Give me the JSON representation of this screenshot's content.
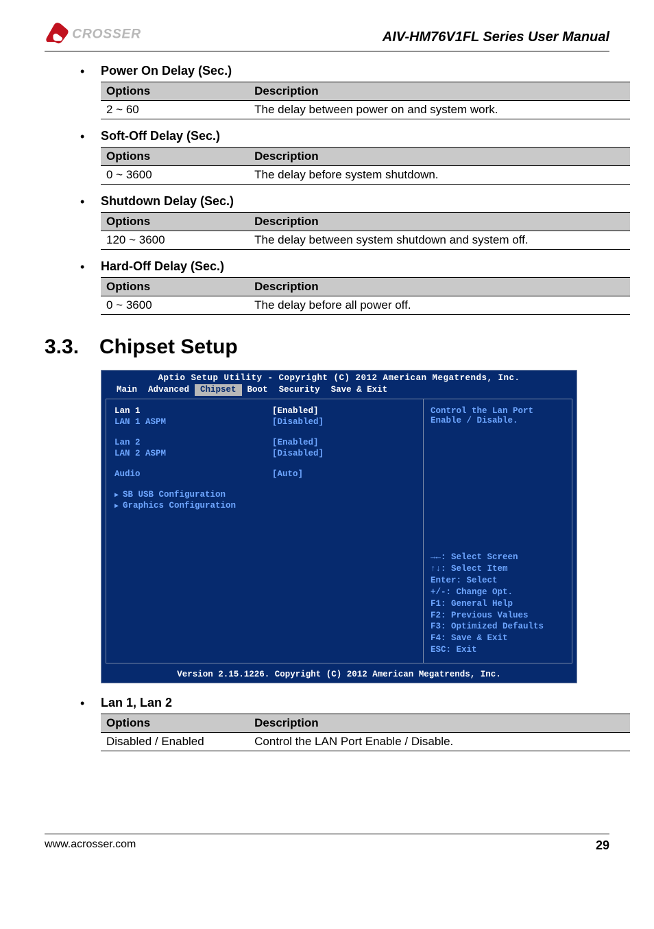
{
  "header": {
    "manual_title": "AIV-HM76V1FL Series User Manual"
  },
  "sections": [
    {
      "title": "Power On Delay (Sec.)",
      "col1_header": "Options",
      "col2_header": "Description",
      "option": "2 ~ 60",
      "description": "The delay between power on and system work."
    },
    {
      "title": "Soft-Off Delay (Sec.)",
      "col1_header": "Options",
      "col2_header": "Description",
      "option": "0 ~ 3600",
      "description": "The delay before system shutdown."
    },
    {
      "title": "Shutdown Delay (Sec.)",
      "col1_header": "Options",
      "col2_header": "Description",
      "option": "120 ~ 3600",
      "description": "The delay between system shutdown and system off."
    },
    {
      "title": "Hard-Off Delay (Sec.)",
      "col1_header": "Options",
      "col2_header": "Description",
      "option": "0 ~ 3600",
      "description": "The delay before all power off."
    }
  ],
  "chipset_heading": {
    "num": "3.3.",
    "title": "Chipset Setup"
  },
  "bios": {
    "title": "Aptio Setup Utility - Copyright (C) 2012 American Megatrends, Inc.",
    "tabs": [
      "Main",
      "Advanced",
      "Chipset",
      "Boot",
      "Security",
      "Save & Exit"
    ],
    "rows": {
      "lan1_label": "Lan 1",
      "lan1_val": "Enabled",
      "lan1aspm_label": "LAN 1 ASPM",
      "lan1aspm_val": "[Disabled]",
      "lan2_label": "Lan 2",
      "lan2_val": "[Enabled]",
      "lan2aspm_label": "LAN 2 ASPM",
      "lan2aspm_val": "[Disabled]",
      "audio_label": "Audio",
      "audio_val": "[Auto]",
      "sub1": "SB USB Configuration",
      "sub2": "Graphics Configuration"
    },
    "help_line1": "Control the Lan Port",
    "help_line2": "Enable / Disable.",
    "keys": {
      "k1": "→←: Select Screen",
      "k2": "↑↓: Select Item",
      "k3": "Enter: Select",
      "k4": "+/-: Change Opt.",
      "k5": "F1: General Help",
      "k6": "F2: Previous Values",
      "k7": "F3: Optimized Defaults",
      "k8": "F4: Save & Exit",
      "k9": "ESC: Exit"
    },
    "footer": "Version 2.15.1226. Copyright (C) 2012 American Megatrends, Inc."
  },
  "lan_section": {
    "title": "Lan 1, Lan 2",
    "col1_header": "Options",
    "col2_header": "Description",
    "option": "Disabled / Enabled",
    "description": "Control the LAN Port Enable / Disable."
  },
  "footer_row": {
    "url": "www.acrosser.com",
    "page": "29"
  }
}
